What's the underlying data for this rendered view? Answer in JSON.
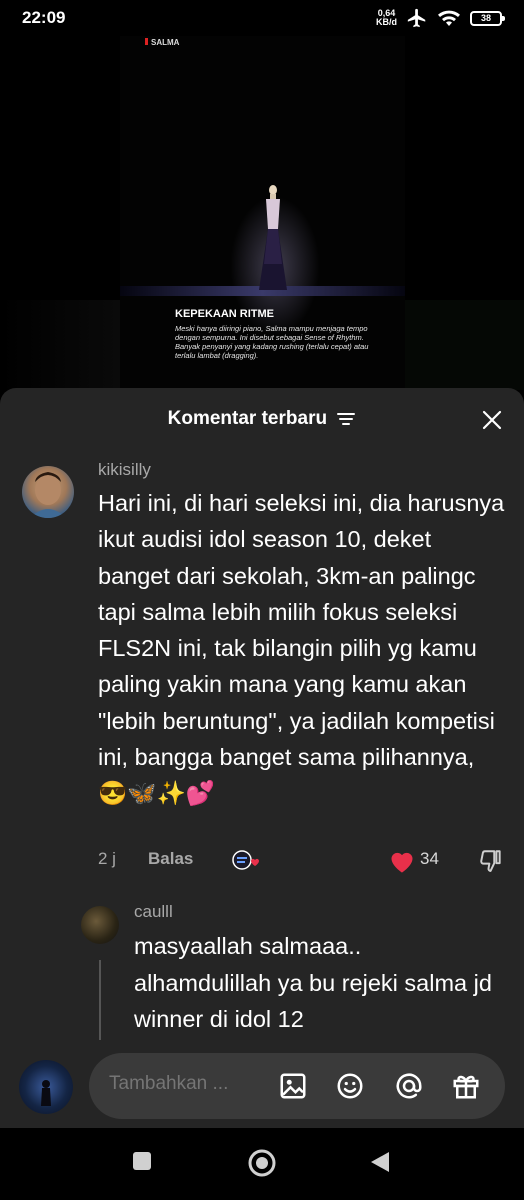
{
  "status_bar": {
    "time": "22:09",
    "net_speed_value": "0,64",
    "net_speed_unit": "KB/d",
    "battery": "38",
    "icons": [
      "airplane-icon",
      "wifi-icon",
      "battery-icon"
    ]
  },
  "video": {
    "brand": "SALMA",
    "caption_title": "KEPEKAAN RITME",
    "caption_body": "Meski hanya diiringi piano, Salma mampu menjaga tempo dengan sempurna. Ini disebut sebagai Sense of Rhythm. Banyak penyanyi yang kadang rushing (terlalu cepat) atau terlalu lambat (dragging)."
  },
  "sheet": {
    "title": "Komentar terbaru"
  },
  "comment": {
    "username": "kikisilly",
    "text": "Hari ini, di hari seleksi ini, dia harusnya ikut audisi idol season 10, deket banget dari sekolah, 3km-an palingc tapi salma lebih milih fokus seleksi FLS2N ini, tak bilangin pilih yg kamu paling yakin mana yang kamu akan \"lebih beruntung\", ya jadilah kompetisi ini, bangga banget sama pilihannya, 😎🦋✨💕",
    "time": "2 j",
    "reply_label": "Balas",
    "likes": "34"
  },
  "reply": {
    "username": "caulll",
    "text": "masyaallah salmaaa.. alhamdulillah ya bu rejeki salma jd winner di idol 12"
  },
  "input": {
    "placeholder": "Tambahkan ..."
  },
  "colors": {
    "sheet_bg": "#252525",
    "like_red": "#e8304a",
    "input_bg": "#3a3a3a"
  }
}
